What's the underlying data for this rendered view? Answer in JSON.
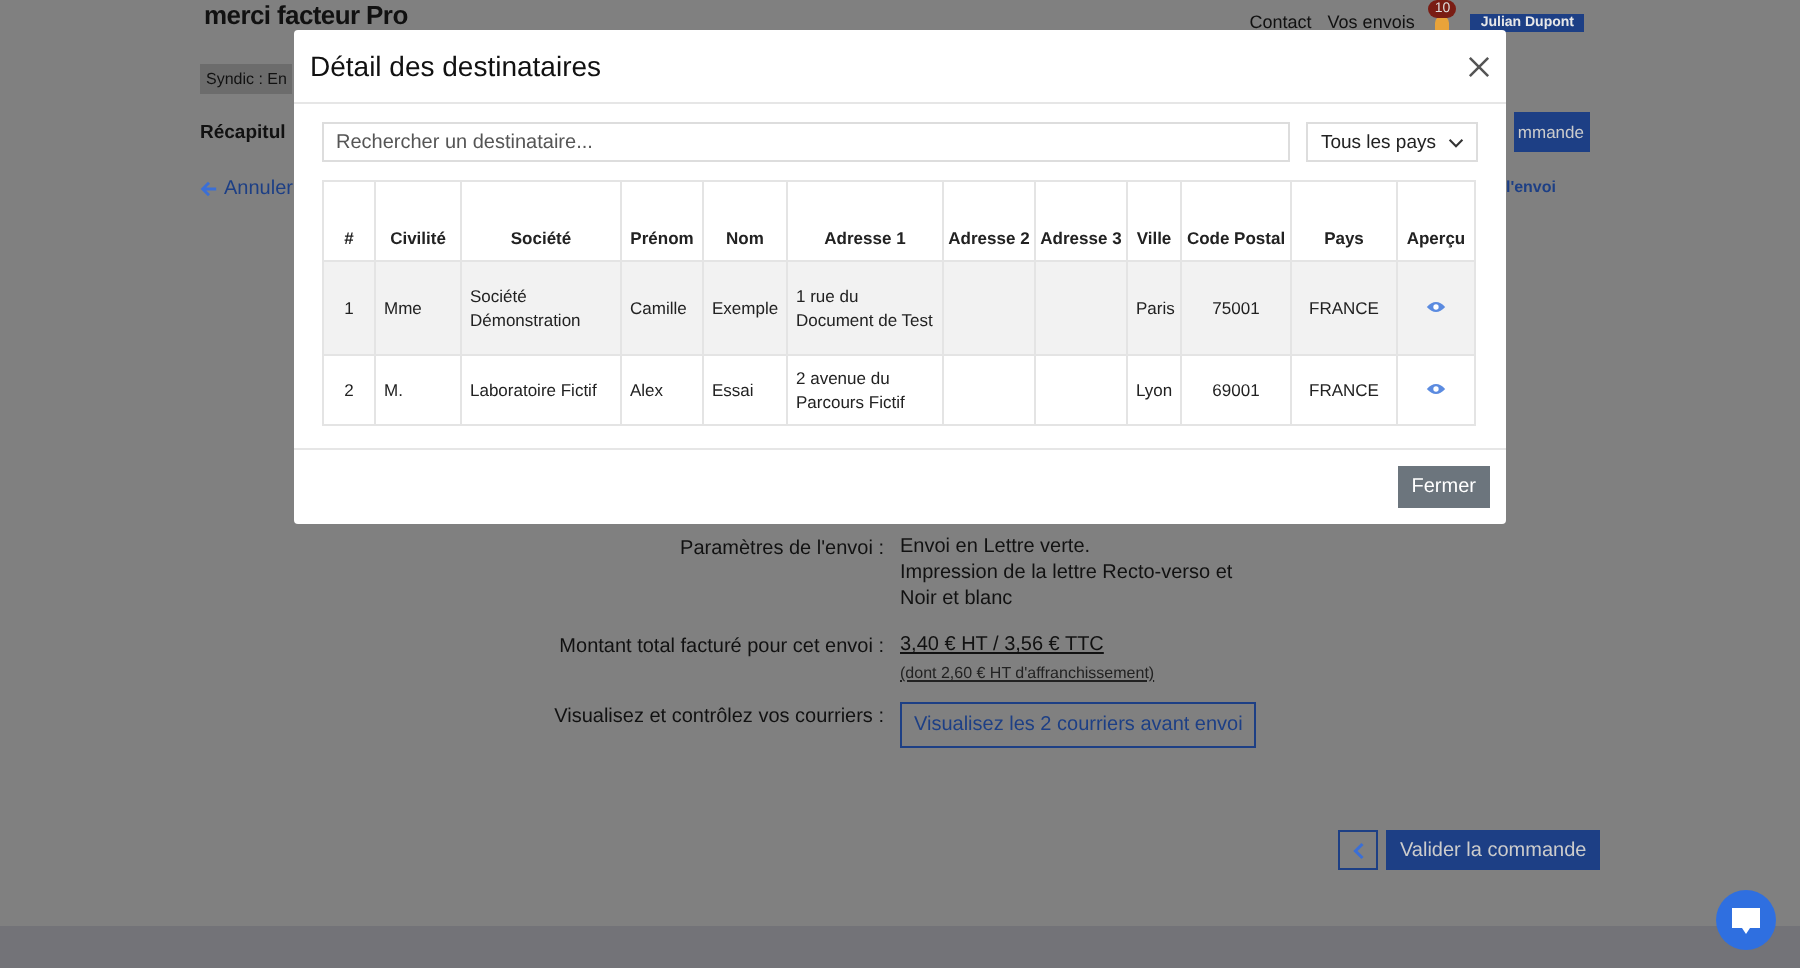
{
  "header": {
    "logo": "merci facteur Pro",
    "links": [
      "Contact",
      "Vos envois"
    ],
    "notification_count": "10",
    "user": "Julian Dupont"
  },
  "breadcrumb": "Syndic : En",
  "page_title": "Récapitul",
  "top_button": "mmande",
  "back_link": "Annuler",
  "side_link": "l'envoi",
  "details": [
    {
      "kind": "text",
      "label": "Paramètres de l'envoi :",
      "lines": [
        "Envoi en Lettre verte.",
        "Impression de la lettre Recto-verso et Noir et blanc"
      ]
    },
    {
      "kind": "price",
      "label": "Montant total facturé pour cet envoi :",
      "value": "3,40 € HT / 3,56 € TTC",
      "note": "(dont 2,60 € HT d'affranchissement)"
    },
    {
      "kind": "button",
      "label": "Visualisez et contrôlez vos courriers :",
      "value": "Visualisez les 2 courriers avant envoi"
    }
  ],
  "validate_button": "Valider la commande",
  "modal": {
    "title": "Détail des destinataires",
    "search": {
      "placeholder": "Rechercher un destinataire..."
    },
    "country_filter": "Tous les pays",
    "table": {
      "columns": [
        "#",
        "Civilité",
        "Société",
        "Prénom",
        "Nom",
        "Adresse 1",
        "Adresse 2",
        "Adresse 3",
        "Ville",
        "Code Postal",
        "Pays",
        "Aperçu"
      ],
      "rows": [
        [
          "1",
          "Mme",
          "Société Démonstration",
          "Camille",
          "Exemple",
          "1 rue du Document de Test",
          "",
          "",
          "Paris",
          "75001",
          "FRANCE"
        ],
        [
          "2",
          "M.",
          "Laboratoire Fictif",
          "Alex",
          "Essai",
          "2 avenue du Parcours Fictif",
          "",
          "",
          "Lyon",
          "69001",
          "FRANCE"
        ]
      ]
    },
    "close_button": "Fermer"
  }
}
